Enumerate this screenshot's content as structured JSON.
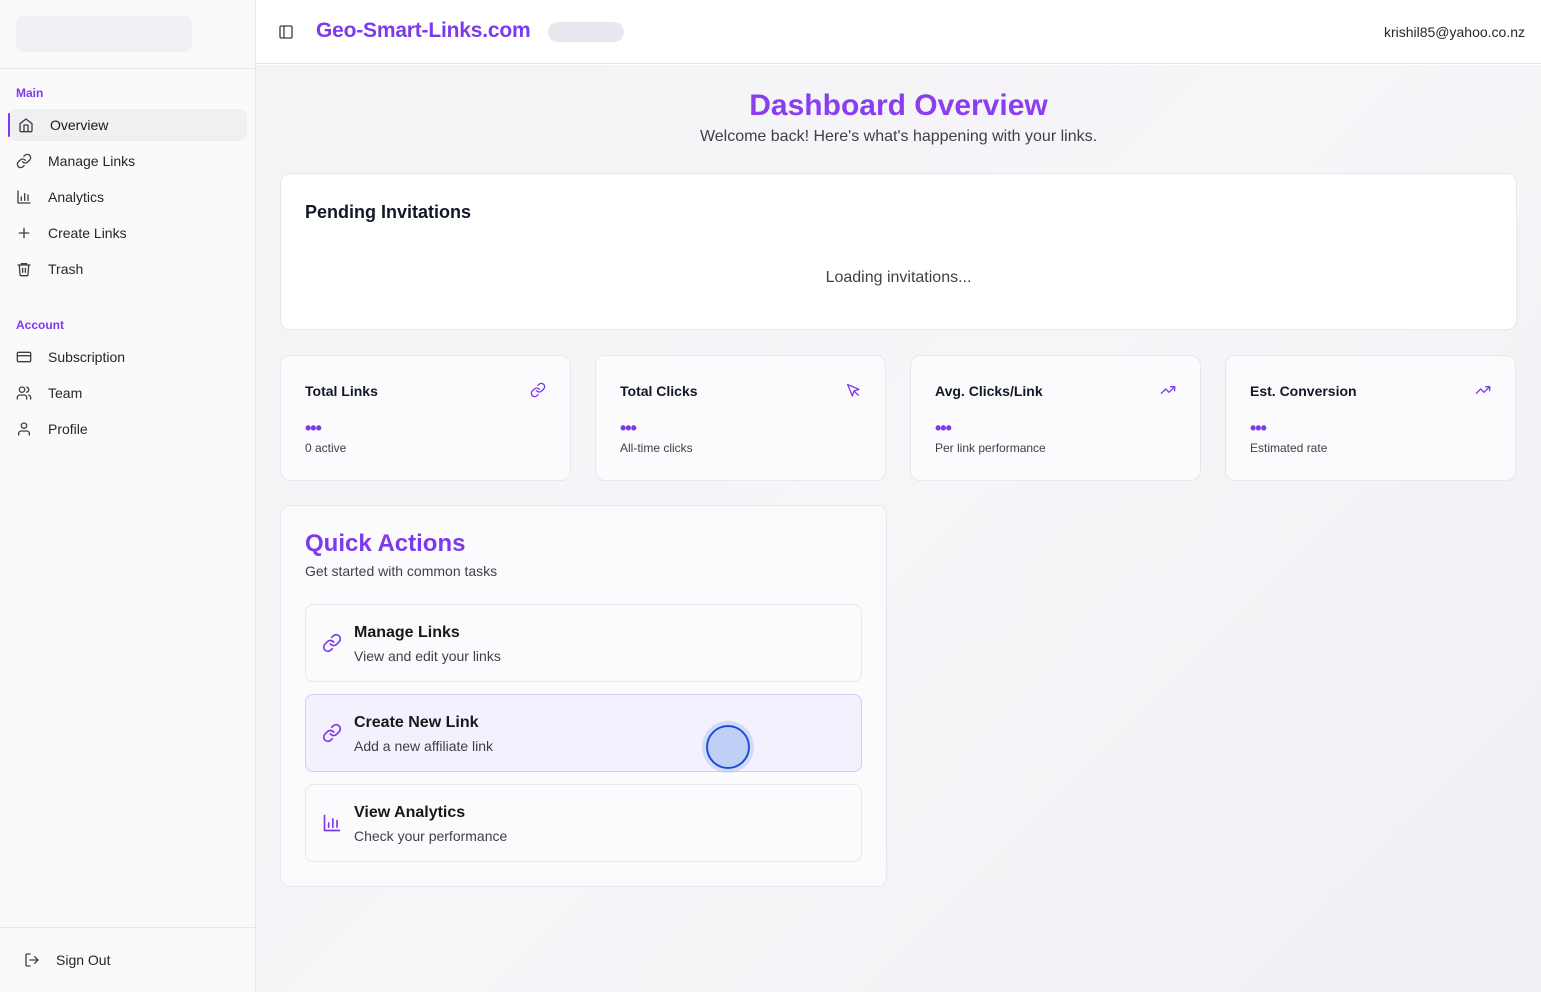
{
  "sidebar": {
    "groups": [
      {
        "label": "Main"
      },
      {
        "label": "Account"
      }
    ],
    "main_items": [
      {
        "label": "Overview",
        "icon": "home-icon",
        "active": true
      },
      {
        "label": "Manage Links",
        "icon": "link-icon"
      },
      {
        "label": "Analytics",
        "icon": "bar-chart-icon"
      },
      {
        "label": "Create Links",
        "icon": "plus-icon"
      },
      {
        "label": "Trash",
        "icon": "trash-icon"
      }
    ],
    "account_items": [
      {
        "label": "Subscription",
        "icon": "credit-card-icon"
      },
      {
        "label": "Team",
        "icon": "users-icon"
      },
      {
        "label": "Profile",
        "icon": "user-icon"
      }
    ],
    "sign_out": "Sign Out"
  },
  "header": {
    "brand": "Geo-Smart-Links.com",
    "user_email": "krishil85@yahoo.co.nz"
  },
  "main": {
    "title": "Dashboard Overview",
    "subtitle": "Welcome back! Here's what's happening with your links.",
    "invitations": {
      "title": "Pending Invitations",
      "status": "Loading invitations..."
    },
    "stats": [
      {
        "label": "Total Links",
        "value": "•••",
        "sub": "0 active",
        "icon": "link-icon"
      },
      {
        "label": "Total Clicks",
        "value": "•••",
        "sub": "All-time clicks",
        "icon": "cursor-click-icon"
      },
      {
        "label": "Avg. Clicks/Link",
        "value": "•••",
        "sub": "Per link performance",
        "icon": "trending-up-icon"
      },
      {
        "label": "Est. Conversion",
        "value": "•••",
        "sub": "Estimated rate",
        "icon": "trending-up-icon"
      }
    ],
    "quick_actions": {
      "title": "Quick Actions",
      "description": "Get started with common tasks",
      "items": [
        {
          "name": "Manage Links",
          "sub": "View and edit your links",
          "icon": "link-icon"
        },
        {
          "name": "Create New Link",
          "sub": "Add a new affiliate link",
          "icon": "link-icon"
        },
        {
          "name": "View Analytics",
          "sub": "Check your performance",
          "icon": "bar-chart-icon"
        }
      ]
    }
  },
  "colors": {
    "accent": "#7c3aed",
    "background": "#f4f3f6"
  }
}
